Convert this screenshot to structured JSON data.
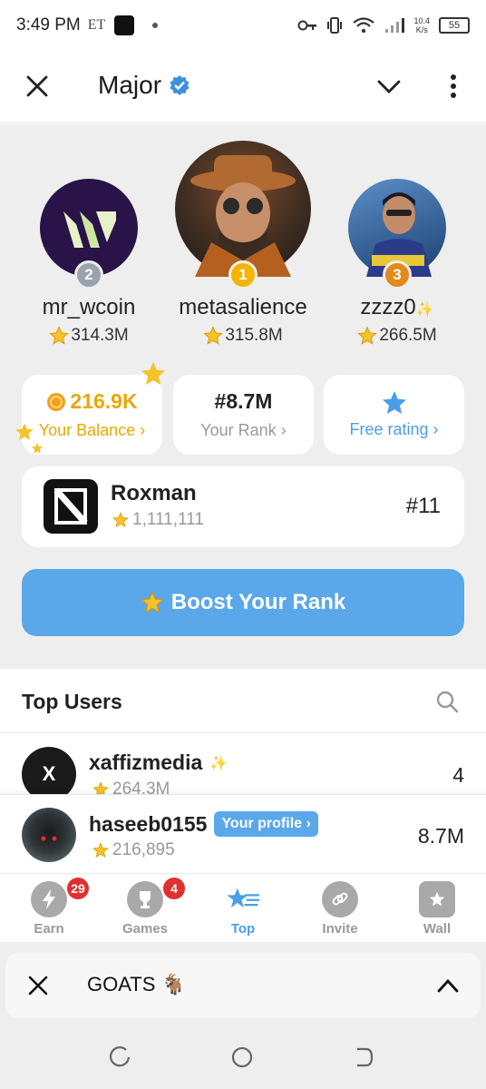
{
  "status_bar": {
    "time": "3:49 PM",
    "carrier": "ET",
    "speed_top": "10.4",
    "speed_bottom": "K/s",
    "battery": "55"
  },
  "header": {
    "title": "Major"
  },
  "podium": [
    {
      "name": "mr_wcoin",
      "score": "314.3M",
      "rank": "2",
      "badge_color": "#9aa3ad"
    },
    {
      "name": "metasalience",
      "score": "315.8M",
      "rank": "1",
      "badge_color": "#f4b400"
    },
    {
      "name": "zzzz0",
      "score": "266.5M",
      "rank": "3",
      "badge_color": "#e28a1b"
    }
  ],
  "stats": {
    "balance_value": "216.9K",
    "balance_label": "Your Balance ›",
    "rank_value": "#8.7M",
    "rank_label": "Your Rank ›",
    "free_label": "Free rating ›"
  },
  "featured": {
    "name": "Roxman",
    "score": "1,111,111",
    "rank": "#11"
  },
  "boost_label": "Boost Your Rank",
  "top_users": {
    "title": "Top Users",
    "rows": [
      {
        "name": "xaffizmedia",
        "score": "264.3M",
        "value": "4",
        "avatar_letter": "X"
      },
      {
        "name": "haseeb0155",
        "score": "216,895",
        "value": "8.7M",
        "tag": "Your profile ›"
      }
    ]
  },
  "nav": [
    {
      "label": "Earn",
      "badge": "29"
    },
    {
      "label": "Games",
      "badge": "4"
    },
    {
      "label": "Top"
    },
    {
      "label": "Invite"
    },
    {
      "label": "Wall"
    }
  ],
  "miniapp": {
    "name": "GOATS 🐐"
  },
  "colors": {
    "accent": "#5aa8ea",
    "gold": "#e9a800",
    "badge_red": "#e03030"
  }
}
